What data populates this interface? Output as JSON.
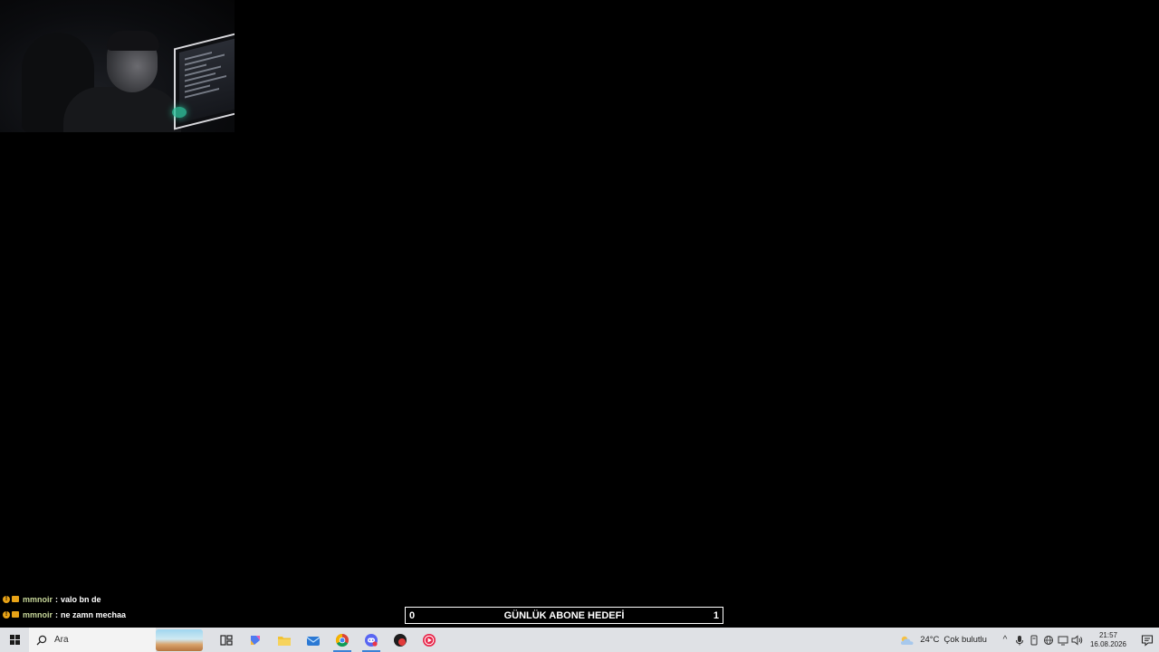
{
  "chat": {
    "messages": [
      {
        "user": "mmnoir",
        "sep": ":",
        "text": "valo bn de"
      },
      {
        "user": "mmnoir",
        "sep": ":",
        "text": "ne zamn mechaa"
      }
    ]
  },
  "goal": {
    "current": "0",
    "title": "GÜNLÜK ABONE HEDEFİ",
    "target": "1"
  },
  "taskbar": {
    "search_placeholder": "Ara",
    "apps": [
      "task-view",
      "copilot",
      "file-explorer",
      "mail",
      "chrome",
      "discord",
      "app-red",
      "media-player"
    ],
    "weather_temp": "24°C",
    "weather_desc": "Çok bulutlu",
    "time": "21:57",
    "date": "16.08.2026"
  },
  "colors": {
    "accent": "#3b82d6",
    "chat_user": "#c8d89a",
    "badge": "#e8a317",
    "taskbar_bg": "#dfe1e5"
  }
}
